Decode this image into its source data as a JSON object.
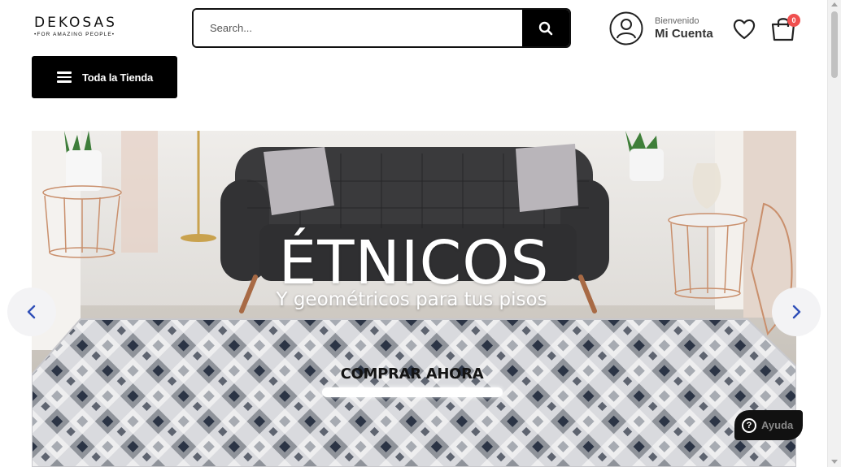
{
  "brand": {
    "name": "DEKOSAS",
    "tagline": "•FOR AMAZING PEOPLE•"
  },
  "search": {
    "placeholder": "Search...",
    "icon": "search-icon"
  },
  "account": {
    "welcome": "Bienvenido",
    "label": "Mi Cuenta",
    "icon": "user-icon"
  },
  "wishlist": {
    "icon": "heart-icon"
  },
  "cart": {
    "icon": "shopping-bag-icon",
    "count": "0",
    "badge_color": "#f0504f"
  },
  "nav": {
    "store_button": "Toda la Tienda",
    "icon": "menu-icon"
  },
  "hero": {
    "title": "ÉTNICOS",
    "subtitle": "Y geométricos para tus pisos",
    "cta": "COMPRAR AHORA",
    "prev_icon": "chevron-left-icon",
    "next_icon": "chevron-right-icon",
    "accent": "#2f4fb8"
  },
  "help": {
    "label": "Ayuda",
    "icon": "question-icon"
  }
}
